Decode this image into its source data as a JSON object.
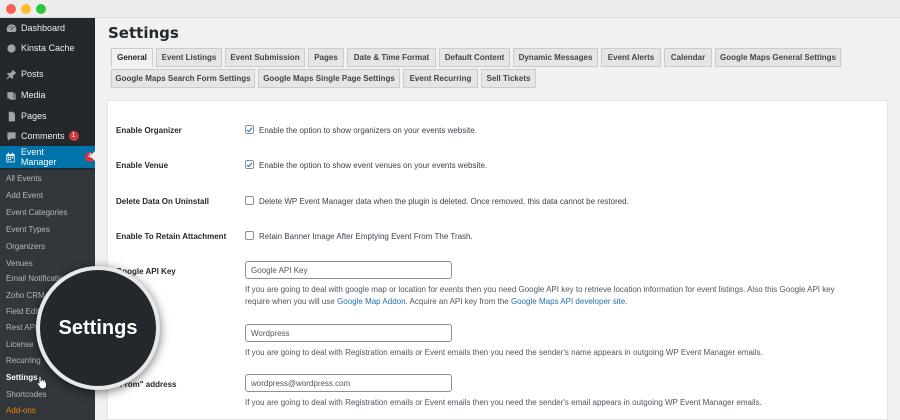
{
  "window": {
    "controls": [
      "close",
      "minimize",
      "maximize"
    ]
  },
  "sidebar": {
    "items": [
      {
        "label": "Dashboard",
        "icon": "dashboard-icon"
      },
      {
        "label": "Kinsta Cache",
        "icon": "kinsta-icon"
      },
      {
        "label": "Posts",
        "icon": "pin-icon"
      },
      {
        "label": "Media",
        "icon": "media-icon"
      },
      {
        "label": "Pages",
        "icon": "pages-icon"
      },
      {
        "label": "Comments",
        "icon": "comment-icon",
        "badge": "1"
      },
      {
        "label": "Event Manager",
        "icon": "calendar-icon",
        "badge": "4"
      }
    ],
    "submenu": [
      "All Events",
      "Add Event",
      "Event Categories",
      "Event Types",
      "Organizers",
      "Venues",
      "Email Notifications",
      "Zoho CRM",
      "Field Editor",
      "Rest API",
      "License",
      "Recurring",
      "Settings",
      "Shortcodes",
      "Add-ons"
    ]
  },
  "page": {
    "title": "Settings"
  },
  "tabs": {
    "row1": [
      "General",
      "Event Listings",
      "Event Submission",
      "Pages",
      "Date & Time Format",
      "Default Content",
      "Dynamic Messages",
      "Event Alerts",
      "Calendar",
      "Google Maps General Settings"
    ],
    "row2": [
      "Google Maps Search Form Settings",
      "Google Maps Single Page Settings",
      "Event Recurring",
      "Sell Tickets"
    ],
    "active": "General"
  },
  "settings": {
    "organizer": {
      "label": "Enable Organizer",
      "text": "Enable the option to show organizers on your events website.",
      "checked": true
    },
    "venue": {
      "label": "Enable Venue",
      "text": "Enable the option to show event venues on your events website.",
      "checked": true
    },
    "delete_data": {
      "label": "Delete Data On Uninstall",
      "text": "Delete WP Event Manager data when the plugin is deleted. Once removed, this data cannot be restored.",
      "checked": false
    },
    "retain": {
      "label": "Enable To Retain Attachment",
      "text": "Retain Banner Image After Emptying Event From The Trash.",
      "checked": false
    },
    "api_key": {
      "label": "Google API Key",
      "placeholder": "Google API Key",
      "desc_line1": "If you are going to deal with google map or location for events then you need Google API key to retrieve location information for event listings. Also this Google API key",
      "desc_line2_pre": "require when you will use ",
      "link1": "Google Map Addon",
      "desc_line2_mid": ". Acquire an API key from the ",
      "link2": "Google Maps API developer site",
      "desc_line2_post": "."
    },
    "from_name": {
      "value": "Wordpress",
      "desc": "If you are going to deal with Registration emails or Event emails then you need the sender's name appears in outgoing WP Event Manager emails."
    },
    "from_address": {
      "label_partial": "\"From\" address",
      "value": "wordpress@wordpress.com",
      "desc": "If you are going to deal with Registration emails or Event emails then you need the sender's email appears in outgoing WP Event Manager emails."
    }
  },
  "magnifier": {
    "text": "Settings"
  },
  "colors": {
    "sidebar_bg": "#23282d",
    "active_menu": "#0073aa",
    "link": "#2271b1",
    "badge": "#d63638",
    "addons": "#f18500"
  }
}
